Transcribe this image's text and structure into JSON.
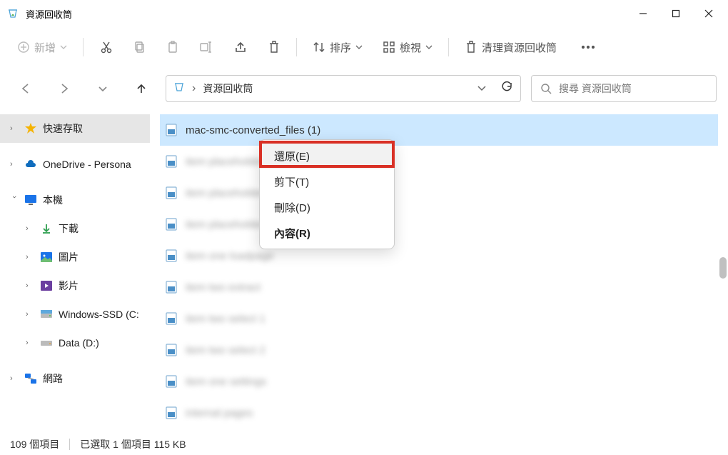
{
  "window": {
    "title": "資源回收筒"
  },
  "toolbar": {
    "new_label": "新增",
    "sort_label": "排序",
    "view_label": "檢視",
    "clean_label": "清理資源回收筒"
  },
  "address": {
    "crumb": "資源回收筒"
  },
  "search": {
    "placeholder": "搜尋 資源回收筒"
  },
  "sidebar": {
    "quick": "快速存取",
    "onedrive": "OneDrive - Persona",
    "thispc": "本機",
    "downloads": "下載",
    "pictures": "圖片",
    "videos": "影片",
    "drive_c": "Windows-SSD (C:",
    "drive_d": "Data (D:)",
    "network": "網路"
  },
  "files": [
    {
      "name": "mac-smc-converted_files (1)",
      "selected": true
    },
    {
      "name": "item placeholder data",
      "blurred": true
    },
    {
      "name": "item placeholder data",
      "blurred": true
    },
    {
      "name": "item placeholder data",
      "blurred": true
    },
    {
      "name": "item one loadpage",
      "blurred": true
    },
    {
      "name": "item two extract",
      "blurred": true
    },
    {
      "name": "item two select 1",
      "blurred": true
    },
    {
      "name": "item two select 2",
      "blurred": true
    },
    {
      "name": "item one settings",
      "blurred": true
    },
    {
      "name": "internal pages",
      "blurred": true
    }
  ],
  "context": {
    "restore": "還原(E)",
    "cut": "剪下(T)",
    "delete": "刪除(D)",
    "properties": "內容(R)"
  },
  "status": {
    "count": "109 個項目",
    "selection": "已選取 1 個項目  115 KB"
  }
}
